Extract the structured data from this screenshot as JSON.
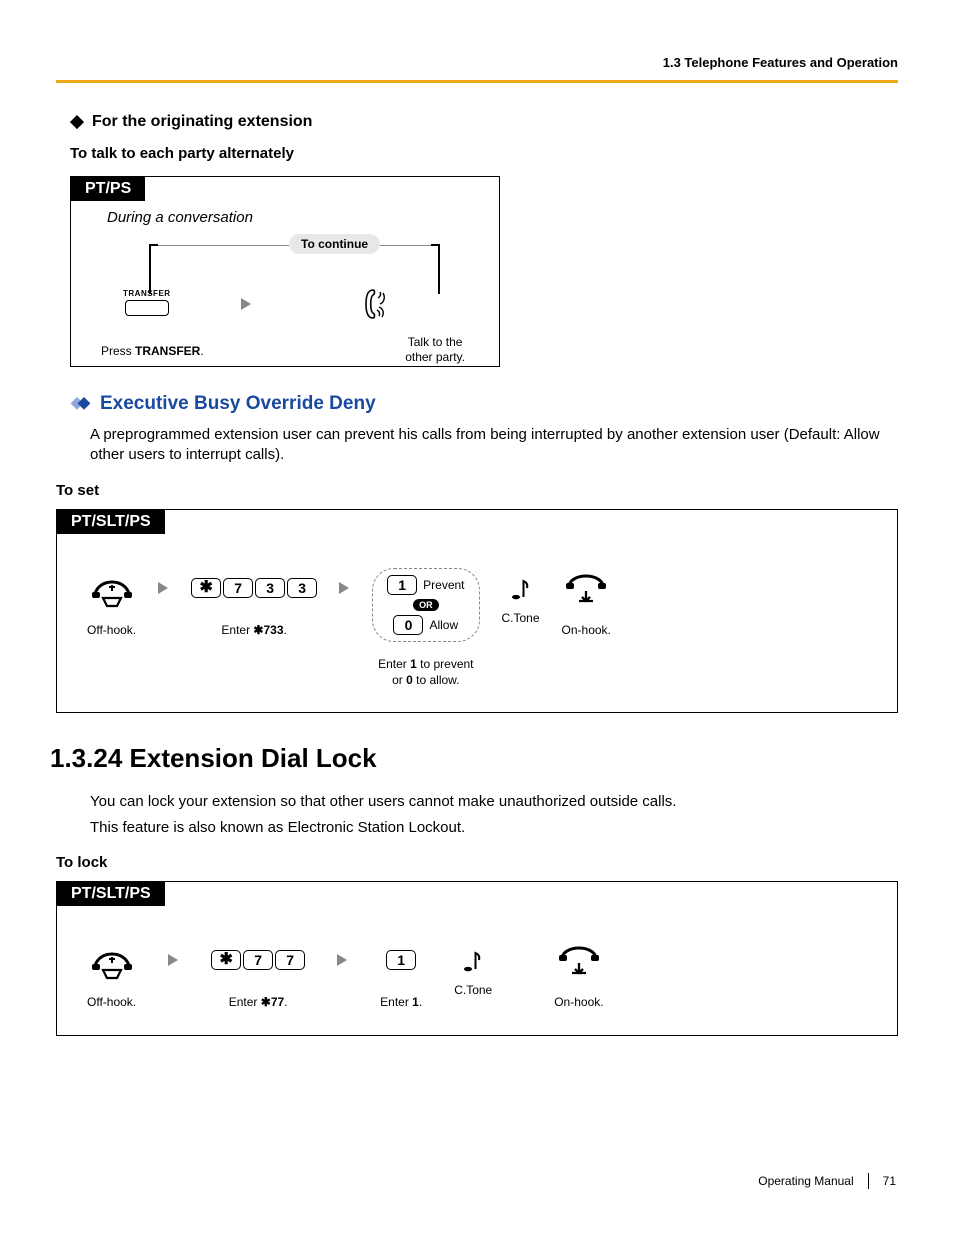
{
  "header": {
    "breadcrumb": "1.3 Telephone Features and Operation"
  },
  "section1": {
    "title": "For the originating extension",
    "subtitle": "To talk to each party alternately",
    "box_tag": "PT/PS",
    "note": "During a conversation",
    "bubble": "To continue",
    "transfer_keycap": "TRANSFER",
    "caption1_pre": "Press ",
    "caption1_bold": "TRANSFER",
    "caption1_post": ".",
    "caption2_l1": "Talk to the",
    "caption2_l2": "other party."
  },
  "section2": {
    "title": "Executive Busy Override Deny",
    "para": "A preprogrammed extension user can prevent his calls from being interrupted by another extension user (Default: Allow other users to interrupt calls).",
    "sub": "To set",
    "box_tag": "PT/SLT/PS",
    "steps": {
      "offhook": "Off-hook.",
      "digits": [
        "7",
        "3",
        "3"
      ],
      "enter_pre": "Enter ",
      "enter_code": "733",
      "enter_post": ".",
      "opt_prevent_key": "1",
      "opt_prevent_label": "Prevent",
      "or": "OR",
      "opt_allow_key": "0",
      "opt_allow_label": "Allow",
      "opt_caption_pre": "Enter ",
      "opt_caption_b1": "1",
      "opt_caption_mid": " to prevent",
      "opt_caption_l2_pre": "or ",
      "opt_caption_b2": "0",
      "opt_caption_l2_post": " to allow.",
      "ctone": "C.Tone",
      "onhook": "On-hook."
    }
  },
  "section3": {
    "title": "1.3.24  Extension Dial Lock",
    "para1": "You can lock your extension so that other users cannot make unauthorized outside calls.",
    "para2": "This feature is also known as Electronic Station Lockout.",
    "sub": "To lock",
    "box_tag": "PT/SLT/PS",
    "steps": {
      "offhook": "Off-hook.",
      "digits": [
        "7",
        "7"
      ],
      "enter_pre": "Enter ",
      "enter_code": "77",
      "enter_post": ".",
      "one_key": "1",
      "one_caption_pre": "Enter ",
      "one_caption_b": "1",
      "one_caption_post": ".",
      "ctone": "C.Tone",
      "onhook": "On-hook."
    }
  },
  "footer": {
    "manual": "Operating Manual",
    "page": "71"
  }
}
